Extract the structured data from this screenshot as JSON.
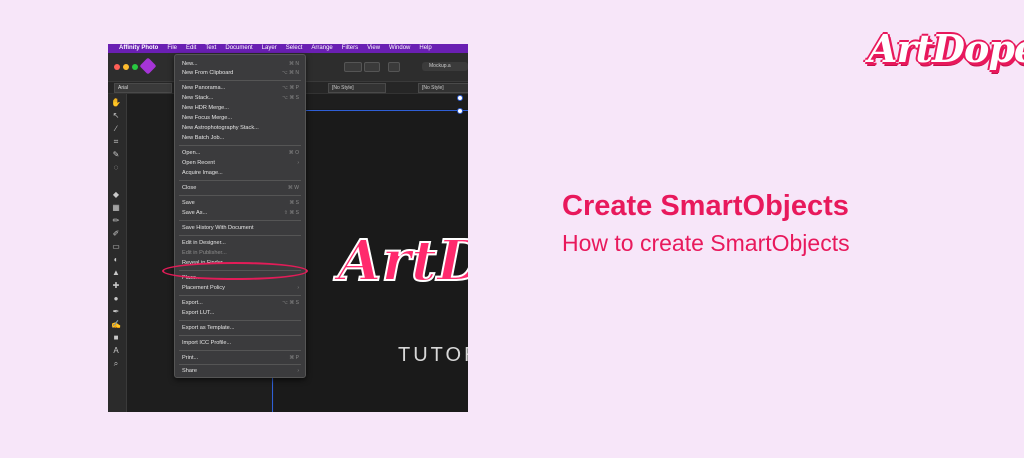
{
  "menubar": {
    "apple_icon": "apple-icon",
    "items": [
      "Affinity Photo",
      "File",
      "Edit",
      "Text",
      "Document",
      "Layer",
      "Select",
      "Arrange",
      "Filters",
      "View",
      "Window",
      "Help"
    ]
  },
  "toolbar": {
    "document_name": "Mockup.a"
  },
  "context_bar": {
    "font": "Arial",
    "style_1": "[No Style]",
    "style_2": "[No Style]"
  },
  "file_menu": {
    "items": [
      {
        "label": "New...",
        "shortcut": "⌘ N"
      },
      {
        "label": "New From Clipboard",
        "shortcut": "⌥ ⌘ N"
      },
      {
        "label": "New Panorama...",
        "shortcut": "⌥ ⌘ P"
      },
      {
        "label": "New Stack...",
        "shortcut": "⌥ ⌘ S"
      },
      {
        "label": "New HDR Merge...",
        "shortcut": ""
      },
      {
        "label": "New Focus Merge...",
        "shortcut": ""
      },
      {
        "label": "New Astrophotography Stack...",
        "shortcut": ""
      },
      {
        "label": "New Batch Job...",
        "shortcut": ""
      },
      {
        "label": "Open...",
        "shortcut": "⌘ O"
      },
      {
        "label": "Open Recent",
        "shortcut": "›"
      },
      {
        "label": "Acquire Image...",
        "shortcut": ""
      },
      {
        "label": "Close",
        "shortcut": "⌘ W"
      },
      {
        "label": "Save",
        "shortcut": "⌘ S"
      },
      {
        "label": "Save As...",
        "shortcut": "⇧ ⌘ S"
      },
      {
        "label": "Save History With Document",
        "shortcut": ""
      },
      {
        "label": "Edit in Designer...",
        "shortcut": ""
      },
      {
        "label": "Edit in Publisher...",
        "shortcut": ""
      },
      {
        "label": "Reveal in Finder",
        "shortcut": ""
      },
      {
        "label": "Place...",
        "shortcut": ""
      },
      {
        "label": "Placement Policy",
        "shortcut": "›"
      },
      {
        "label": "Export...",
        "shortcut": "⌥ ⌘ S"
      },
      {
        "label": "Export LUT...",
        "shortcut": ""
      },
      {
        "label": "Export as Template...",
        "shortcut": ""
      },
      {
        "label": "Import ICC Profile...",
        "shortcut": ""
      },
      {
        "label": "Print...",
        "shortcut": "⌘ P"
      },
      {
        "label": "Share",
        "shortcut": "›"
      }
    ]
  },
  "canvas": {
    "logo_text": "ArtD",
    "caption": "TUTOR"
  },
  "branding": {
    "logo": "ArtDope",
    "headline": "Create SmartObjects",
    "subheadline": "How to create SmartObjects"
  },
  "colors": {
    "accent": "#e8195c",
    "menubar": "#6a1fb3",
    "background": "#f7e6f9"
  }
}
